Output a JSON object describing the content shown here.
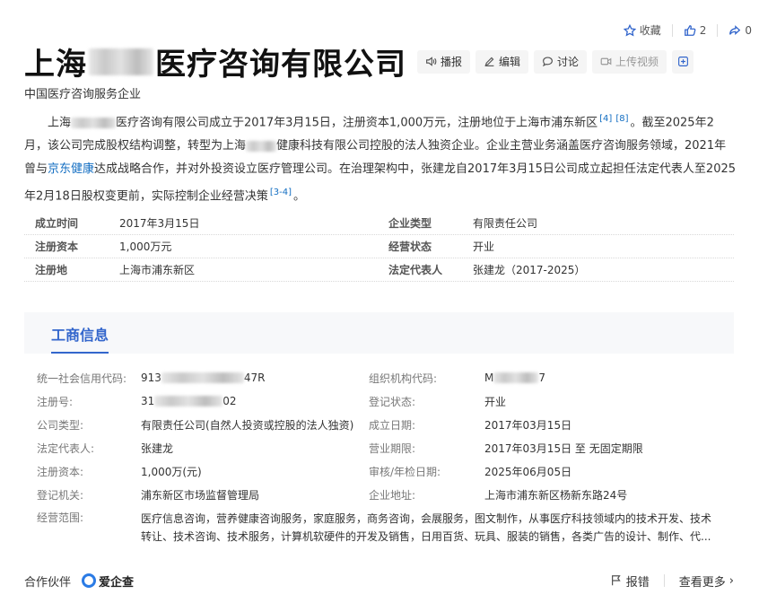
{
  "top_actions": {
    "collect_label": "收藏",
    "like_count": "2",
    "share_count": "0"
  },
  "title": {
    "prefix": "上海",
    "suffix": "医疗咨询有限公司"
  },
  "buttons": {
    "broadcast": "播报",
    "edit": "编辑",
    "discuss": "讨论",
    "upload_video": "上传视频"
  },
  "subtitle": "中国医疗咨询服务企业",
  "intro": {
    "p1_a": "上海",
    "p1_b": "医疗咨询有限公司成立于2017年3月15日，注册资本1,000万元，注册地位于上海市浦东新区",
    "ref1": "[4]",
    "ref2": "[8]",
    "p1_c": "。截至2025年2月，该公司完成股权结构调整，转型为上海",
    "p1_d": "健康科技有限公司控股的法人独资企业。企业主营业务涵盖医疗咨询服务领域，2021年曾与",
    "link": "京东健康",
    "p1_e": "达成战略合作，并对外投资设立医疗管理公司。在治理架构中，张建龙自2017年3月15日公司成立起担任法定代表人至2025年2月18日股权变更前，实际控制企业经营决策",
    "ref3": "[3-4]",
    "p1_f": "。"
  },
  "basic_info": [
    {
      "k1": "成立时间",
      "v1": "2017年3月15日",
      "k2": "企业类型",
      "v2": "有限责任公司"
    },
    {
      "k1": "注册资本",
      "v1": "1,000万元",
      "k2": "经营状态",
      "v2": "开业"
    },
    {
      "k1": "注册地",
      "v1": "上海市浦东新区",
      "k2": "法定代表人",
      "v2": "张建龙（2017-2025）"
    }
  ],
  "biz": {
    "tab": "工商信息",
    "rows": [
      {
        "k1": "统一社会信用代码:",
        "v1a": "913",
        "v1b": "47R",
        "k2": "组织机构代码:",
        "v2a": "M",
        "v2b": "7"
      },
      {
        "k1": "注册号:",
        "v1a": "31",
        "v1b": "02",
        "k2": "登记状态:",
        "v2a": "开业",
        "v2b": ""
      },
      {
        "k1": "公司类型:",
        "v1a": "有限责任公司(自然人投资或控股的法人独资)",
        "v1b": "",
        "k2": "成立日期:",
        "v2a": "2017年03月15日",
        "v2b": ""
      },
      {
        "k1": "法定代表人:",
        "v1a": "张建龙",
        "v1b": "",
        "k2": "营业期限:",
        "v2a": "2017年03月15日 至 无固定期限",
        "v2b": ""
      },
      {
        "k1": "注册资本:",
        "v1a": "1,000万(元)",
        "v1b": "",
        "k2": "审核/年检日期:",
        "v2a": "2025年06月05日",
        "v2b": ""
      },
      {
        "k1": "登记机关:",
        "v1a": "浦东新区市场监督管理局",
        "v1b": "",
        "k2": "企业地址:",
        "v2a": "上海市浦东新区杨新东路24号",
        "v2b": ""
      }
    ],
    "scope_label": "经营范围:",
    "scope_text": "医疗信息咨询，营养健康咨询服务，家庭服务，商务咨询，会展服务，图文制作，从事医疗科技领域内的技术开发、技术转让、技术咨询、技术服务，计算机软硬件的开发及销售，日用百货、玩具、服装的销售，各类广告的设计、制作、代..."
  },
  "footer": {
    "partner_label": "合作伙伴",
    "partner_name": "爱企查",
    "report": "报错",
    "more": "查看更多"
  }
}
